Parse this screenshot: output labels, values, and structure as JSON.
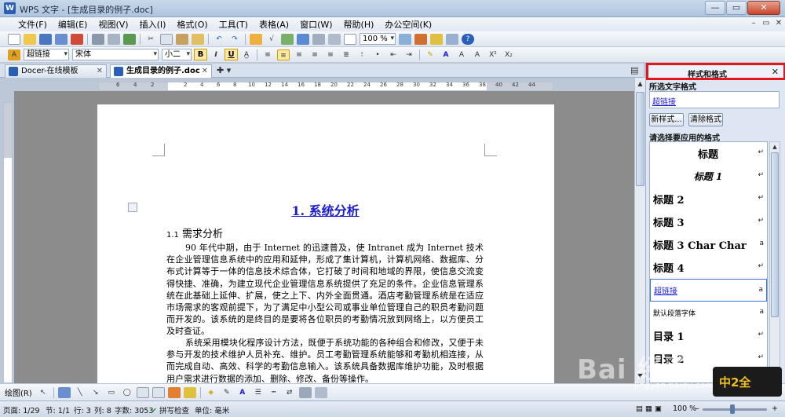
{
  "window": {
    "title": "WPS 文字 - [生成目录的例子.doc]",
    "app_icon_letter": "W",
    "minimize": "—",
    "maximize": "▭",
    "close": "✕"
  },
  "menubar": {
    "items": [
      "文件(F)",
      "编辑(E)",
      "视图(V)",
      "插入(I)",
      "格式(O)",
      "工具(T)",
      "表格(A)",
      "窗口(W)",
      "帮助(H)",
      "办公空间(K)"
    ]
  },
  "toolbar": {
    "zoom_value": "100 %",
    "style_value": "超链接",
    "font_value": "宋体",
    "size_value": "小二",
    "bold": "B",
    "italic": "I",
    "underline": "U"
  },
  "tabs": [
    {
      "label": "Docer-在线模板"
    },
    {
      "label": "生成目录的例子.doc"
    }
  ],
  "ruler": {
    "labels": [
      "6",
      "4",
      "2",
      "2",
      "4",
      "6",
      "8",
      "10",
      "12",
      "14",
      "16",
      "18",
      "20",
      "22",
      "24",
      "26",
      "28",
      "30",
      "32",
      "34",
      "36",
      "38",
      "40",
      "42",
      "44"
    ]
  },
  "document": {
    "heading1": "1.  系统分析",
    "heading2_num": "1.1",
    "heading2_text": "需求分析",
    "para1": "90 年代中期，由于 Internet 的迅速普及，使 Intranet 成为 Internet 技术在企业管理信息系统中的应用和延伸，形成了集计算机，计算机网络、数据库、分布式计算等于一体的信息技术综合体，它打破了时间和地域的界限，使信息交流变得快捷、准确，为建立现代企业管理信息系统提供了充足的条件。企业信息管理系统在此基础上延伸、扩展，使之上下、内外全面贯通。酒店考勤管理系统是在适应市场需求的客观前提下，为了满足中小型公司或事业单位管理自己的职员考勤问题而开发的。该系统的是终目的是要将各位职员的考勤情况放到网络上，以方便员工及时查证。",
    "para2": "系统采用模块化程序设计方法，既便于系统功能的各种组合和修改，又便于未参与开发的技术维护人员补充、维护。员工考勤管理系统能够和考勤机相连接，从而完成自动、高效、科学的考勤信息输入。该系统具备数据库维护功能，及时根据用户需求进行数据的添加、删除、修改、备份等操作。"
  },
  "taskpane": {
    "title": "样式和格式",
    "close": "✕",
    "selected_label": "所选文字格式",
    "current_style": "超链接",
    "new_style_btn": "新样式...",
    "clear_btn": "清除格式",
    "apply_label": "请选择要应用的格式",
    "styles": [
      {
        "label": "标题",
        "mark": "↵"
      },
      {
        "label": "标题 1",
        "mark": "↵"
      },
      {
        "label": "标题 2",
        "mark": "↵"
      },
      {
        "label": "标题 3",
        "mark": "↵"
      },
      {
        "label": "标题 3 Char Char",
        "mark": "a"
      },
      {
        "label": "标题 4",
        "mark": "↵"
      },
      {
        "label": "超链接",
        "mark": "a"
      },
      {
        "label": "默认段落字体",
        "mark": "a"
      },
      {
        "label": "目录 1",
        "mark": "↵"
      },
      {
        "label": "目录 2",
        "mark": "↵"
      }
    ]
  },
  "drawbar": {
    "label": "绘图(R)"
  },
  "statusbar": {
    "page": "页面: 1/29",
    "section": "节: 1/1",
    "row": "行: 3",
    "column": "列: 8",
    "words": "字数: 3053",
    "spell": "拼写检查",
    "unit": "单位: 毫米",
    "zoom": "100 %"
  },
  "watermark": {
    "text": "Bai 经验",
    "sub": "jingyan.baidu.com",
    "logo": "中2全"
  }
}
